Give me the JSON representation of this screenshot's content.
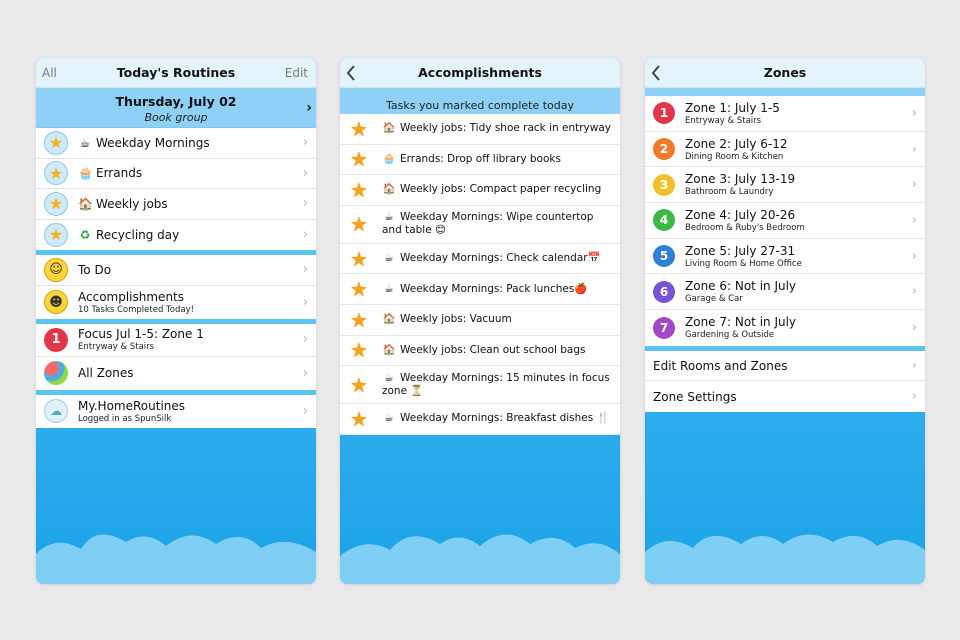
{
  "colors": {
    "sky": "#1aa2e8",
    "band": "#8fd1f6",
    "nav": "#e4f4fc"
  },
  "routines": {
    "nav": {
      "left": "All",
      "title": "Today's Routines",
      "right": "Edit"
    },
    "date": "Thursday, July 02",
    "subtitle": "Book group",
    "routine_items": [
      {
        "emoji": "☕",
        "label": "Weekday Mornings"
      },
      {
        "emoji": "🧁",
        "label": "Errands"
      },
      {
        "emoji": "🏠",
        "label": "Weekly jobs"
      },
      {
        "emoji": "♻",
        "label": "Recycling day"
      }
    ],
    "todo": {
      "label": "To Do"
    },
    "accomplishments": {
      "label": "Accomplishments",
      "detail": "10 Tasks Completed Today!"
    },
    "focus": {
      "number": "1",
      "label": "Focus Jul 1-5: Zone 1",
      "detail": "Entryway & Stairs"
    },
    "all_zones": {
      "label": "All Zones"
    },
    "account": {
      "label": "My.HomeRoutines",
      "detail": "Logged in as SpunSilk"
    }
  },
  "accomplishments_screen": {
    "title": "Accomplishments",
    "header": "Tasks you marked complete today",
    "items": [
      {
        "icon": "🏠",
        "text": "Weekly jobs: Tidy shoe rack in entryway"
      },
      {
        "icon": "🧁",
        "text": "Errands: Drop off library books"
      },
      {
        "icon": "🏠",
        "text": "Weekly jobs: Compact paper recycling"
      },
      {
        "icon": "☕",
        "text": "Weekday Mornings: Wipe countertop and table 😊"
      },
      {
        "icon": "☕",
        "text": "Weekday Mornings: Check calendar📅"
      },
      {
        "icon": "☕",
        "text": "Weekday Mornings: Pack lunches🍎"
      },
      {
        "icon": "🏠",
        "text": "Weekly jobs: Vacuum"
      },
      {
        "icon": "🏠",
        "text": "Weekly jobs: Clean out school bags"
      },
      {
        "icon": "☕",
        "text": "Weekday Mornings: 15 minutes in focus zone ⏳"
      },
      {
        "icon": "☕",
        "text": "Weekday Mornings: Breakfast dishes 🍴"
      }
    ]
  },
  "zones_screen": {
    "title": "Zones",
    "zones": [
      {
        "number": "1",
        "color": "#e2364a",
        "label": "Zone 1: July 1-5",
        "detail": "Entryway & Stairs"
      },
      {
        "number": "2",
        "color": "#f07a2a",
        "label": "Zone 2: July 6-12",
        "detail": "Dining Room & Kitchen"
      },
      {
        "number": "3",
        "color": "#f4c02a",
        "label": "Zone 3: July 13-19",
        "detail": "Bathroom & Laundry"
      },
      {
        "number": "4",
        "color": "#3cb944",
        "label": "Zone 4: July 20-26",
        "detail": "Bedroom & Ruby's Bedroom"
      },
      {
        "number": "5",
        "color": "#2f7fd8",
        "label": "Zone 5: July 27-31",
        "detail": "Living Room & Home Office"
      },
      {
        "number": "6",
        "color": "#7a52d6",
        "label": "Zone 6: Not in July",
        "detail": "Garage & Car"
      },
      {
        "number": "7",
        "color": "#a248c7",
        "label": "Zone 7: Not in July",
        "detail": "Gardening & Outside"
      }
    ],
    "settings": [
      {
        "label": "Edit Rooms and Zones"
      },
      {
        "label": "Zone Settings"
      }
    ]
  }
}
